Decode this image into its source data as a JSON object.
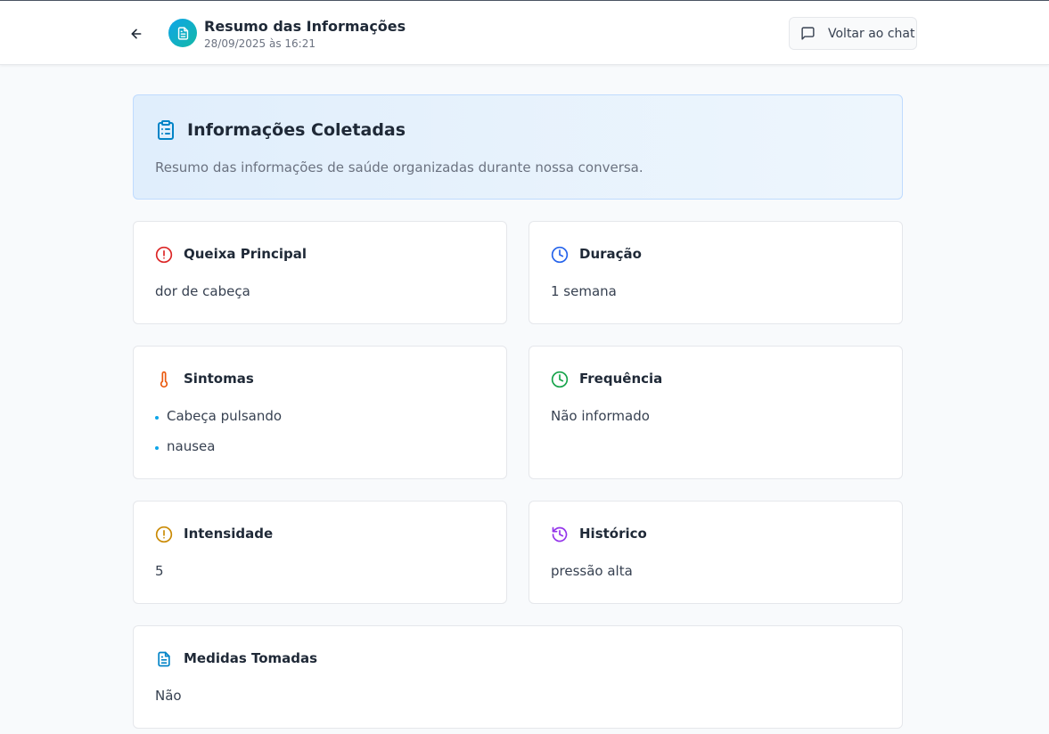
{
  "header": {
    "title": "Resumo das Informações",
    "subtitle": "28/09/2025 às 16:21",
    "chat_button": "Voltar ao chat"
  },
  "intro": {
    "title": "Informações Coletadas",
    "description": "Resumo das informações de saúde organizadas durante nossa conversa."
  },
  "cards": {
    "queixa": {
      "title": "Queixa Principal",
      "value": "dor de cabeça",
      "icon": "alert-circle-icon",
      "color": "#dc2626"
    },
    "duracao": {
      "title": "Duração",
      "value": "1 semana",
      "icon": "clock-icon",
      "color": "#2563eb"
    },
    "sintomas": {
      "title": "Sintomas",
      "items": [
        "Cabeça pulsando",
        "nausea"
      ],
      "icon": "thermometer-icon",
      "color": "#ea580c"
    },
    "frequencia": {
      "title": "Frequência",
      "value": "Não informado",
      "icon": "clock-icon",
      "color": "#16a34a"
    },
    "intensidade": {
      "title": "Intensidade",
      "value": "5",
      "icon": "alert-circle-icon",
      "color": "#ca8a04"
    },
    "historico": {
      "title": "Histórico",
      "value": "pressão alta",
      "icon": "history-icon",
      "color": "#9333ea"
    },
    "medidas": {
      "title": "Medidas Tomadas",
      "value": "Não",
      "icon": "document-icon",
      "color": "#0284c7"
    }
  }
}
